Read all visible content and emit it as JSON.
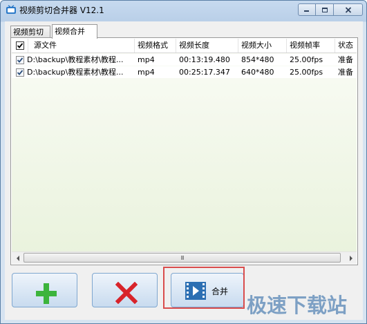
{
  "window": {
    "title": "视频剪切合并器 V12.1",
    "controls": {
      "minimize": "minimize",
      "maximize": "maximize",
      "close": "close"
    }
  },
  "tabs": [
    {
      "label": "视频剪切",
      "active": false
    },
    {
      "label": "视频合并",
      "active": true
    }
  ],
  "table": {
    "select_all_checked": true,
    "columns": [
      "源文件",
      "视频格式",
      "视频长度",
      "视频大小",
      "视频帧率",
      "状态"
    ],
    "rows": [
      {
        "checked": true,
        "file": "D:\\backup\\教程素材\\教程...",
        "format": "mp4",
        "duration": "00:13:19.480",
        "size": "854*480",
        "fps": "25.00fps",
        "status": "准备"
      },
      {
        "checked": true,
        "file": "D:\\backup\\教程素材\\教程...",
        "format": "mp4",
        "duration": "00:25:17.347",
        "size": "640*480",
        "fps": "25.00fps",
        "status": "准备"
      }
    ],
    "scrollbar_grip": "III"
  },
  "buttons": {
    "add_icon": "plus-icon",
    "remove_icon": "x-icon",
    "merge_label": "合并",
    "merge_icon": "film-icon"
  },
  "watermark": "极速下载站",
  "colors": {
    "accent_red": "#d94c4c",
    "plus_green": "#3cb43c",
    "x_red": "#d8232a",
    "film_blue": "#2c6fb3"
  }
}
